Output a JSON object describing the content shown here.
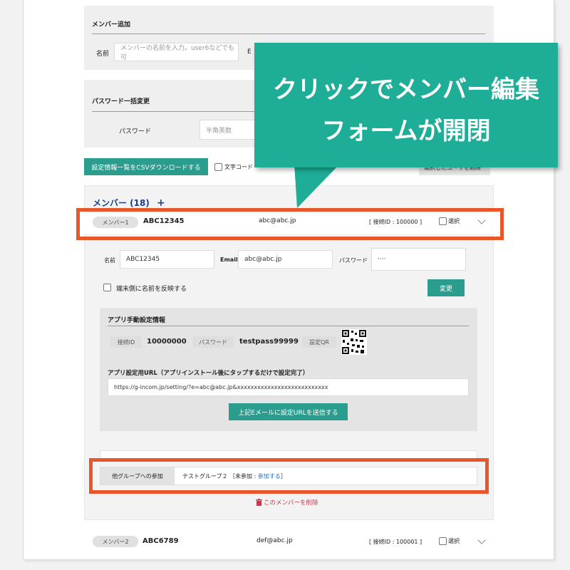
{
  "add_member": {
    "title": "メンバー追加",
    "name_label": "名前",
    "name_placeholder": "メンバーの名前を入力。user6などでも可",
    "email_label_partial": "E"
  },
  "password_bulk": {
    "title": "パスワード一括変更",
    "password_label": "パスワード",
    "password_placeholder": "半角英数"
  },
  "toolbar": {
    "csv_button": "設定情報一覧をCSVダウンロードする",
    "charcode_label_partial": "文字コード",
    "delete_selected_partial": "選択したユーザを削除"
  },
  "members": {
    "heading": "メンバー (18)",
    "add_icon": "+",
    "list": [
      {
        "tag": "メンバー1",
        "id": "ABC12345",
        "email": "abc@abc.jp",
        "conn": "[ 接続ID : 100000 ]",
        "select_label": "選択"
      },
      {
        "tag": "メンバー2",
        "id": "ABC6789",
        "email": "def@abc.jp",
        "conn": "[ 接続ID : 100001 ]",
        "select_label": "選択"
      }
    ]
  },
  "edit_form": {
    "name_label": "名前",
    "name_value": "ABC12345",
    "email_label": "Email",
    "email_value": "abc@abc.jp",
    "password_label": "パスワード",
    "password_value": "····",
    "reflect_label": "端末側に名前を反映する",
    "change_button": "変更",
    "app_settings_title": "アプリ手動設定情報",
    "conn_id_tag": "接続ID",
    "conn_id_value": "10000000",
    "password_tag": "パスワード",
    "password_tag_value": "testpass99999",
    "qr_tag": "設定QR",
    "url_title": "アプリ設定用URL（アプリインストール後にタップするだけで設定完了）",
    "url_value": "https://g-incom.jp/setting/?e=abc@abc.jp&xxxxxxxxxxxxxxxxxxxxxxxxxxx",
    "send_button": "上記Eメールに設定URLを送信する",
    "other_group_label": "他グループへの参加",
    "other_group_value_prefix": "テストグループ２ ［未参加 : ",
    "other_group_join": "参加する",
    "other_group_value_suffix": "］",
    "delete_member": "このメンバーを削除"
  },
  "callout": {
    "line1": "クリックでメンバー編集",
    "line2": "フォームが開閉"
  },
  "colors": {
    "accent_green": "#2a9d8f",
    "callout_teal": "#1eae98",
    "highlight_orange": "#e8572a",
    "link_blue": "#1a73c8",
    "delete_red": "#c8384a"
  },
  "icons": [
    "plus-icon",
    "chevron-down-icon",
    "trash-icon",
    "qr-code-icon"
  ]
}
